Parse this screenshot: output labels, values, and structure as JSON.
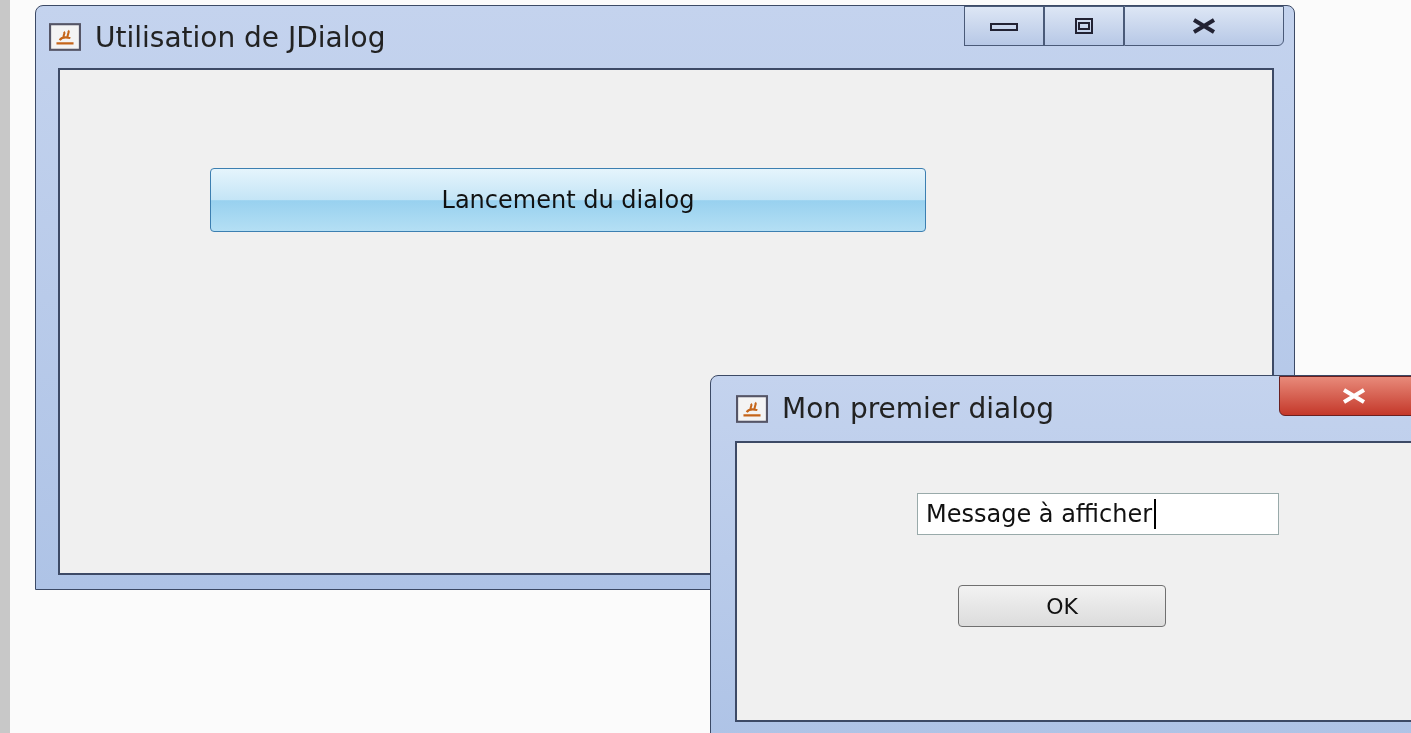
{
  "main_window": {
    "title": "Utilisation de JDialog",
    "button": "Lancement du dialog"
  },
  "dialog": {
    "title": "Mon premier dialog",
    "field": {
      "value": "Message à afficher",
      "focused": true
    },
    "button": "OK"
  }
}
